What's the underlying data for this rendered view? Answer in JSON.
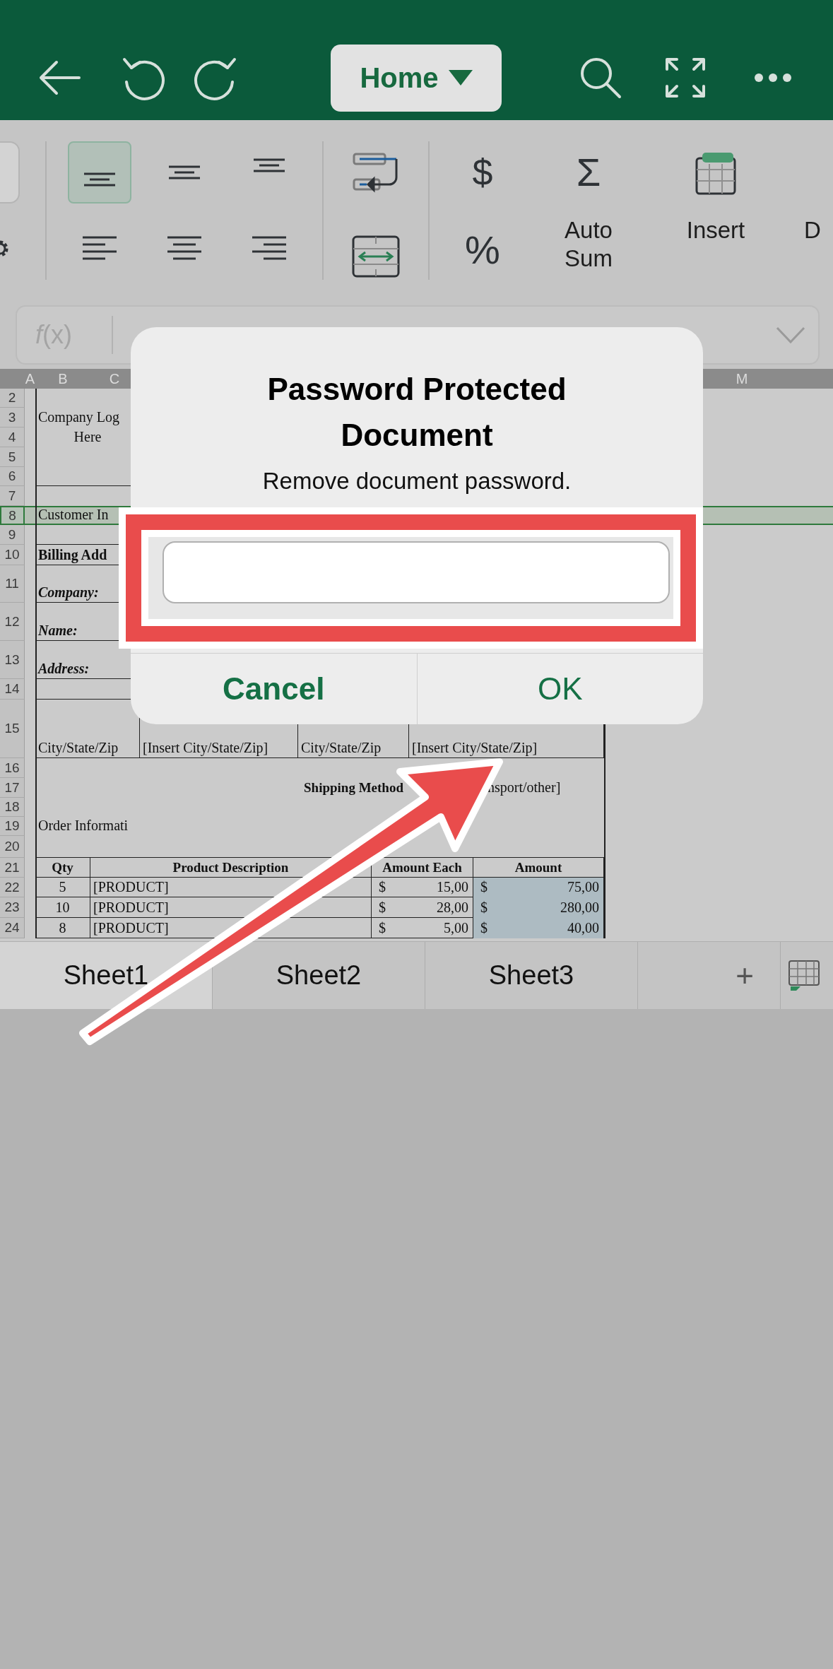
{
  "toolbar": {
    "menu": {
      "label": "Home"
    }
  },
  "ribbon": {
    "alignment_buttons": [
      {
        "selected": true
      },
      {
        "selected": false
      },
      {
        "selected": false
      },
      {
        "selected": false
      },
      {
        "selected": false
      },
      {
        "selected": false
      }
    ],
    "currency_symbol": "$",
    "percent_symbol": "%",
    "autosum": {
      "symbol": "Σ",
      "label": "Auto Sum"
    },
    "insert": {
      "label": "Insert"
    },
    "next_label": "D"
  },
  "formula_bar": {
    "label": "*f*(x)"
  },
  "sheet": {
    "column_headers": [
      "A",
      "B",
      "C",
      "M"
    ],
    "row_headers": [
      {
        "label": "2",
        "selected": false
      },
      {
        "label": "3",
        "selected": false
      },
      {
        "label": "4",
        "selected": false
      },
      {
        "label": "5",
        "selected": false
      },
      {
        "label": "6",
        "selected": false
      },
      {
        "label": "7",
        "selected": false
      },
      {
        "label": "8",
        "selected": true
      },
      {
        "label": "9",
        "selected": false
      },
      {
        "label": "10",
        "selected": false
      },
      {
        "label": "11",
        "selected": false
      },
      {
        "label": "12",
        "selected": false
      },
      {
        "label": "13",
        "selected": false
      },
      {
        "label": "14",
        "selected": false
      },
      {
        "label": "15",
        "selected": false
      },
      {
        "label": "16",
        "selected": false
      },
      {
        "label": "17",
        "selected": false
      },
      {
        "label": "18",
        "selected": false
      },
      {
        "label": "19",
        "selected": false
      },
      {
        "label": "20",
        "selected": false
      },
      {
        "label": "21",
        "selected": false
      },
      {
        "label": "22",
        "selected": false
      },
      {
        "label": "23",
        "selected": false
      },
      {
        "label": "24",
        "selected": false
      }
    ],
    "logo_text": [
      "Company Log",
      "Here"
    ],
    "section_title": "Customer In",
    "billing_heading": "Billing Add",
    "billing_labels": [
      "Company:",
      "Name:",
      "Address:"
    ],
    "city_row": [
      "City/State/Zip",
      "[Insert City/State/Zip]",
      "City/State/Zip",
      "[Insert City/State/Zip]"
    ],
    "shipping_label": "Shipping Method",
    "shipping_value": "nsport/other]",
    "order_heading": "Order Informati",
    "order_table": {
      "columns": [
        "Qty",
        "Product Description",
        "Amount Each",
        "Amount"
      ],
      "rows": [
        {
          "qty": "5",
          "product": "[PRODUCT]",
          "unit_currency": "$",
          "unit_price": "15,00",
          "amount_currency": "$",
          "amount": "75,00",
          "amount_selected": true
        },
        {
          "qty": "10",
          "product": "[PRODUCT]",
          "unit_currency": "$",
          "unit_price": "28,00",
          "amount_currency": "$",
          "amount": "280,00",
          "amount_selected": true
        },
        {
          "qty": "8",
          "product": "[PRODUCT]",
          "unit_currency": "$",
          "unit_price": "5,00",
          "amount_currency": "$",
          "amount": "40,00",
          "amount_selected": true
        }
      ]
    }
  },
  "sheet_tabs": [
    {
      "label": "Sheet1",
      "selected": true
    },
    {
      "label": "Sheet2",
      "selected": false
    },
    {
      "label": "Sheet3",
      "selected": false
    }
  ],
  "add_sheet": "+",
  "dialog": {
    "title": "Password Protected Document",
    "message": "Remove document password.",
    "buttons": [
      {
        "label": "Cancel",
        "kind": "cancel"
      },
      {
        "label": "OK",
        "kind": "default"
      }
    ]
  }
}
